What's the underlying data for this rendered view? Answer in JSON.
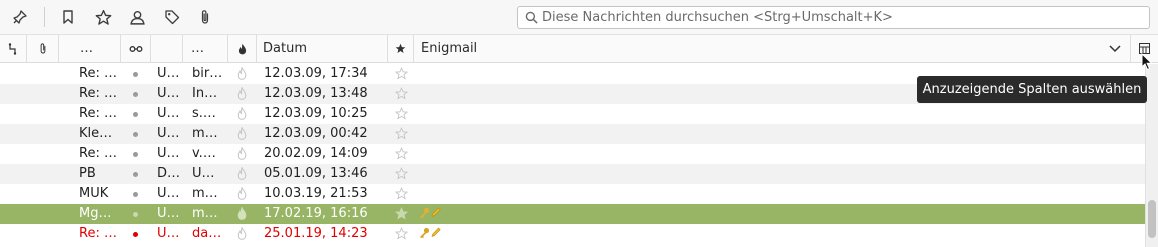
{
  "toolbar": {
    "buttons": [
      {
        "name": "pin-icon"
      },
      {
        "name": "bookmark-icon"
      },
      {
        "name": "star-icon"
      },
      {
        "name": "contact-icon"
      },
      {
        "name": "tag-icon"
      },
      {
        "name": "paperclip-icon"
      }
    ],
    "search_placeholder": "Diese Nachrichten durchsuchen <Strg+Umschalt+K>"
  },
  "columns": {
    "thread_icon": "thread-icon",
    "attachment_icon": "paperclip-icon",
    "col3": "…",
    "read_icon": "read-status-icon",
    "col5": "…",
    "junk_icon": "junk-flame-icon",
    "datum": "Datum",
    "star_icon": "star-icon",
    "enigmail": "Enigmail",
    "picker_icon": "column-picker-icon"
  },
  "messages": [
    {
      "subject": "Re: …",
      "status": "U…",
      "sender": "bir…",
      "date": "12.03.09, 17:34",
      "enigmail": "",
      "style": "normal"
    },
    {
      "subject": "Re: …",
      "status": "U…",
      "sender": "In…",
      "date": "12.03.09, 13:48",
      "enigmail": "",
      "style": "alt"
    },
    {
      "subject": "Re: …",
      "status": "U…",
      "sender": "s.…",
      "date": "12.03.09, 10:25",
      "enigmail": "",
      "style": "normal"
    },
    {
      "subject": "Kle…",
      "status": "U…",
      "sender": "m…",
      "date": "12.03.09, 00:42",
      "enigmail": "",
      "style": "alt"
    },
    {
      "subject": "Re: …",
      "status": "U…",
      "sender": "v.…",
      "date": "20.02.09, 14:09",
      "enigmail": "",
      "style": "normal"
    },
    {
      "subject": "PB",
      "status": "D…",
      "sender": "U…",
      "date": "05.01.09, 13:46",
      "enigmail": "",
      "style": "alt"
    },
    {
      "subject": "MUK",
      "status": "U…",
      "sender": "m…",
      "date": "10.03.19, 21:53",
      "enigmail": "",
      "style": "normal"
    },
    {
      "subject": "Mg…",
      "status": "U…",
      "sender": "m…",
      "date": "17.02.19, 16:16",
      "enigmail": "key-pencil-icons",
      "style": "sel"
    },
    {
      "subject": "Re: …",
      "status": "U…",
      "sender": "da…",
      "date": "25.01.19, 14:23",
      "enigmail": "key-pencil-icons",
      "style": "red"
    }
  ],
  "tooltip": "Anzuzeigende Spalten auswählen",
  "colors": {
    "selected_row": "#97b565",
    "unread_red": "#e00000",
    "key_icon": "#d9a520"
  }
}
